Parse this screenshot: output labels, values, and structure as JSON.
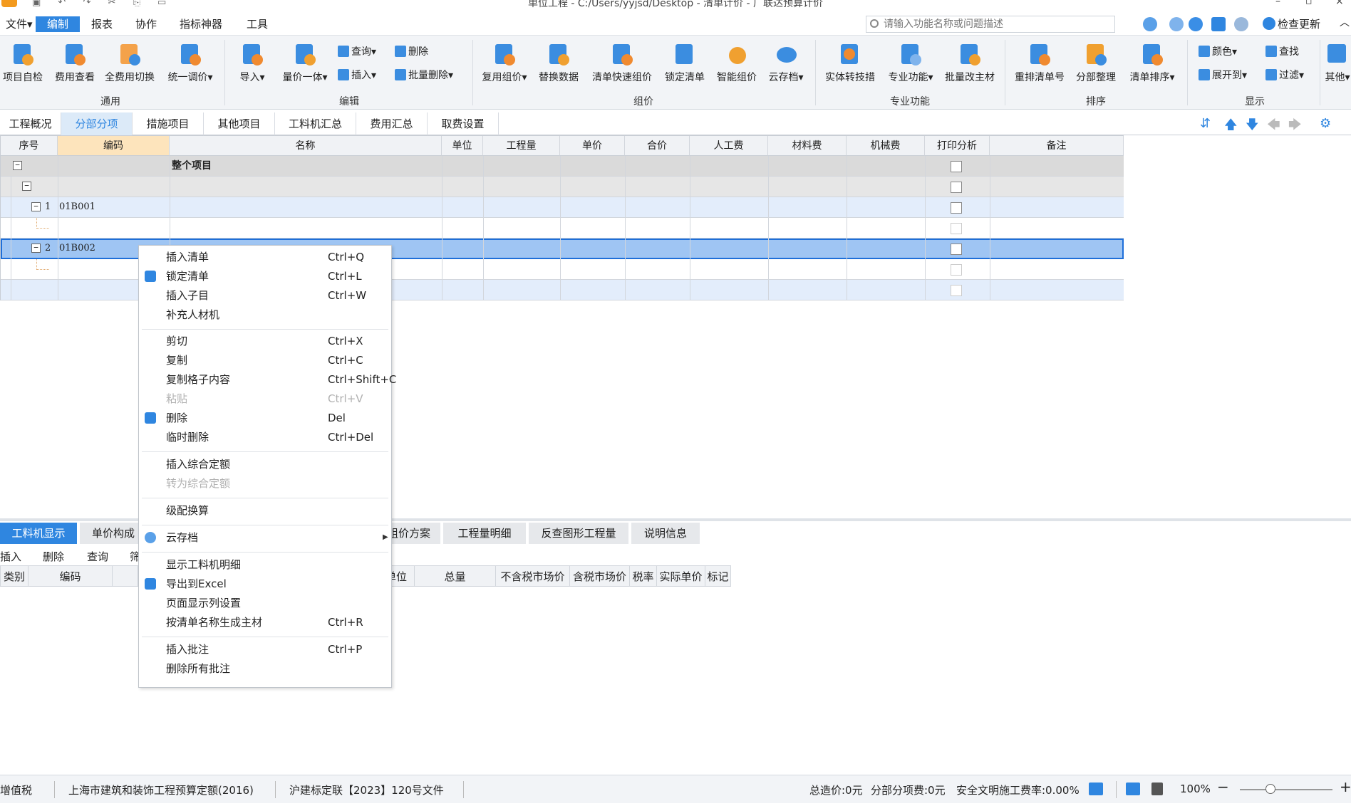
{
  "window": {
    "title": "单位工程 - C:/Users/yyjsd/Desktop - 清单计价 - 广联达预算计价"
  },
  "menubar": {
    "items": [
      "文件▾",
      "编制",
      "报表",
      "协作",
      "指标神器",
      "工具"
    ],
    "active_index": 1,
    "search_placeholder": "请输入功能名称或问题描述",
    "check_update": "检查更新"
  },
  "ribbon": {
    "buttons": [
      {
        "label": "项目自检",
        "icon": "project-check-icon"
      },
      {
        "label": "费用查看",
        "icon": "cost-view-icon"
      },
      {
        "label": "全费用切换",
        "icon": "full-cost-switch-icon"
      },
      {
        "label": "统一调价▾",
        "icon": "unified-price-icon"
      },
      {
        "label": "导入▾",
        "icon": "import-icon"
      },
      {
        "label": "量价一体▾",
        "icon": "quantity-price-icon"
      },
      {
        "label": "复用组价▾",
        "icon": "reuse-pricing-icon"
      },
      {
        "label": "替换数据",
        "icon": "replace-data-icon"
      },
      {
        "label": "清单快速组价",
        "icon": "quick-pricing-icon"
      },
      {
        "label": "锁定清单",
        "icon": "lock-list-icon"
      },
      {
        "label": "智能组价",
        "icon": "smart-pricing-icon"
      },
      {
        "label": "云存档▾",
        "icon": "cloud-archive-icon"
      },
      {
        "label": "实体转技措",
        "icon": "entity-convert-icon"
      },
      {
        "label": "专业功能▾",
        "icon": "professional-icon"
      },
      {
        "label": "批量改主材",
        "icon": "batch-material-icon"
      },
      {
        "label": "重排清单号",
        "icon": "renumber-icon"
      },
      {
        "label": "分部整理",
        "icon": "section-organize-icon"
      },
      {
        "label": "清单排序▾",
        "icon": "list-sort-icon"
      },
      {
        "label": "其他▾",
        "icon": "other-grid-icon"
      }
    ],
    "small_buttons": [
      {
        "label": "查询▾",
        "icon": "query-icon"
      },
      {
        "label": "删除",
        "icon": "delete-icon"
      },
      {
        "label": "插入▾",
        "icon": "insert-icon"
      },
      {
        "label": "批量删除▾",
        "icon": "batch-delete-icon"
      },
      {
        "label": "颜色▾",
        "icon": "color-icon"
      },
      {
        "label": "查找",
        "icon": "find-icon"
      },
      {
        "label": "展开到▾",
        "icon": "expand-to-icon"
      },
      {
        "label": "过滤▾",
        "icon": "filter-icon"
      }
    ],
    "groups": [
      "通用",
      "编辑",
      "组价",
      "专业功能",
      "排序",
      "显示"
    ]
  },
  "tabs": [
    "工程概况",
    "分部分项",
    "措施项目",
    "其他项目",
    "工料机汇总",
    "费用汇总",
    "取费设置"
  ],
  "active_tab": 1,
  "grid": {
    "headers": [
      "序号",
      "编码",
      "名称",
      "单位",
      "工程量",
      "单价",
      "合价",
      "人工费",
      "材料费",
      "机械费",
      "打印分析",
      "备注"
    ],
    "rows": [
      {
        "seq": "",
        "code": "",
        "name": "整个项目"
      },
      {
        "seq": "",
        "code": "",
        "name": ""
      },
      {
        "seq": "1",
        "code": "01B001",
        "name": ""
      },
      {
        "seq": "",
        "code": "",
        "name": ""
      },
      {
        "seq": "2",
        "code": "01B002",
        "name": ""
      },
      {
        "seq": "",
        "code": "",
        "name": ""
      },
      {
        "seq": "",
        "code": "",
        "name": ""
      }
    ]
  },
  "context_menu": {
    "items": [
      {
        "label": "插入清单",
        "shortcut": "Ctrl+Q",
        "icon": ""
      },
      {
        "label": "锁定清单",
        "shortcut": "Ctrl+L",
        "icon": "lock-icon"
      },
      {
        "label": "插入子目",
        "shortcut": "Ctrl+W",
        "icon": ""
      },
      {
        "label": "补充人材机",
        "shortcut": "",
        "icon": ""
      },
      {
        "label": "剪切",
        "shortcut": "Ctrl+X",
        "icon": ""
      },
      {
        "label": "复制",
        "shortcut": "Ctrl+C",
        "icon": ""
      },
      {
        "label": "复制格子内容",
        "shortcut": "Ctrl+Shift+C",
        "icon": ""
      },
      {
        "label": "粘贴",
        "shortcut": "Ctrl+V",
        "icon": "",
        "disabled": true
      },
      {
        "label": "删除",
        "shortcut": "Del",
        "icon": "trash-icon"
      },
      {
        "label": "临时删除",
        "shortcut": "Ctrl+Del",
        "icon": ""
      },
      {
        "label": "插入综合定额",
        "shortcut": "",
        "icon": ""
      },
      {
        "label": "转为综合定额",
        "shortcut": "",
        "icon": "",
        "disabled": true
      },
      {
        "label": "级配换算",
        "shortcut": "",
        "icon": ""
      },
      {
        "label": "云存档",
        "shortcut": "",
        "icon": "cloud-icon",
        "submenu": true
      },
      {
        "label": "显示工料机明细",
        "shortcut": "",
        "icon": ""
      },
      {
        "label": "导出到Excel",
        "shortcut": "",
        "icon": "excel-export-icon"
      },
      {
        "label": "页面显示列设置",
        "shortcut": "",
        "icon": ""
      },
      {
        "label": "按清单名称生成主材",
        "shortcut": "Ctrl+R",
        "icon": ""
      },
      {
        "label": "插入批注",
        "shortcut": "Ctrl+P",
        "icon": ""
      },
      {
        "label": "删除所有批注",
        "shortcut": "",
        "icon": ""
      }
    ]
  },
  "bottom_tabs": [
    "工料机显示",
    "单价构成",
    "组价方案",
    "工程量明细",
    "反查图形工程量",
    "说明信息"
  ],
  "bottom_toolbar": [
    "插入",
    "删除",
    "查询",
    "筛"
  ],
  "bottom_grid_headers": [
    "类别",
    "编码",
    "单位",
    "总量",
    "不含税市场价",
    "含税市场价",
    "税率",
    "实际单价",
    "标记"
  ],
  "statusbar": {
    "tax": "增值税",
    "quota": "上海市建筑和装饰工程预算定额(2016)",
    "doc": "沪建标定联【2023】120号文件",
    "total": "总造价:0元",
    "section_fee": "分部分项费:0元",
    "safety_rate": "安全文明施工费率:0.00%",
    "zoom": "100%"
  },
  "colors": {
    "accent": "#2f86e0",
    "selected_row": "#9fc5f3",
    "header_highlight": "#fde4bc"
  }
}
